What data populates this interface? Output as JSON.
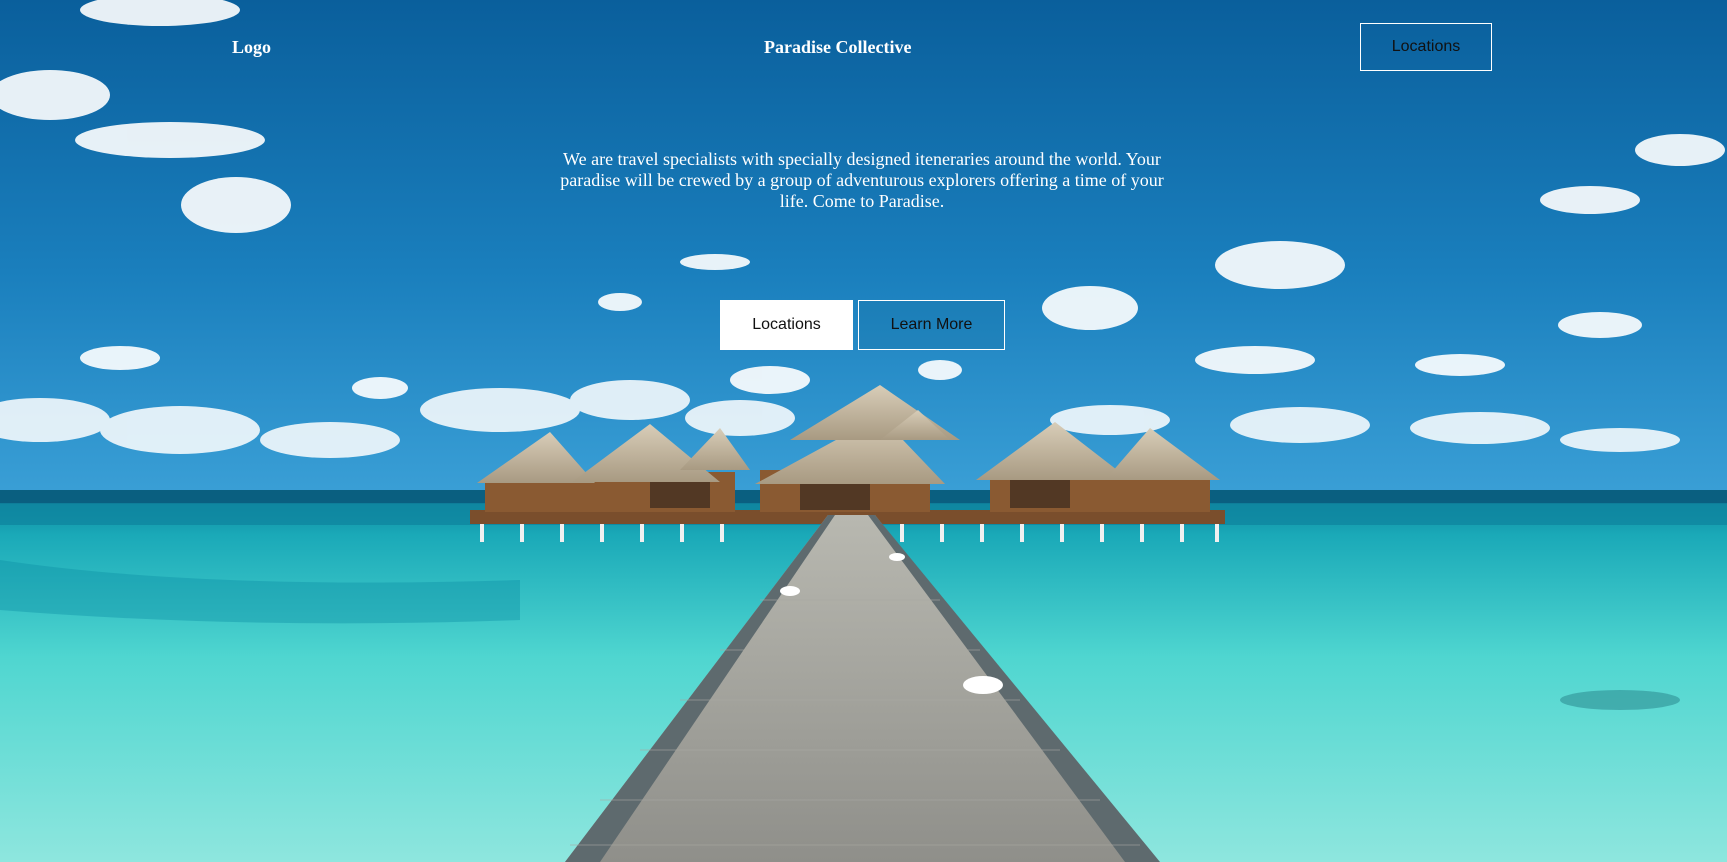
{
  "header": {
    "logo_text": "Logo",
    "brand_name": "Paradise Collective",
    "nav_button_label": "Locations"
  },
  "hero": {
    "tagline": "We are travel specialists with specially designed iteneraries around the world. Your paradise will be crewed by a group of adventurous explorers offering a time of your life. Come to Paradise.",
    "primary_button_label": "Locations",
    "secondary_button_label": "Learn More",
    "background_image": "overwater-bungalows-with-pier-photo"
  },
  "colors": {
    "sky_top": "#0a5f9c",
    "sky_bottom": "#2f95cf",
    "sea_light": "#4fd6d0",
    "sea_deep": "#0a8fa8",
    "text_on_image": "#ffffff",
    "button_text": "#111111"
  }
}
